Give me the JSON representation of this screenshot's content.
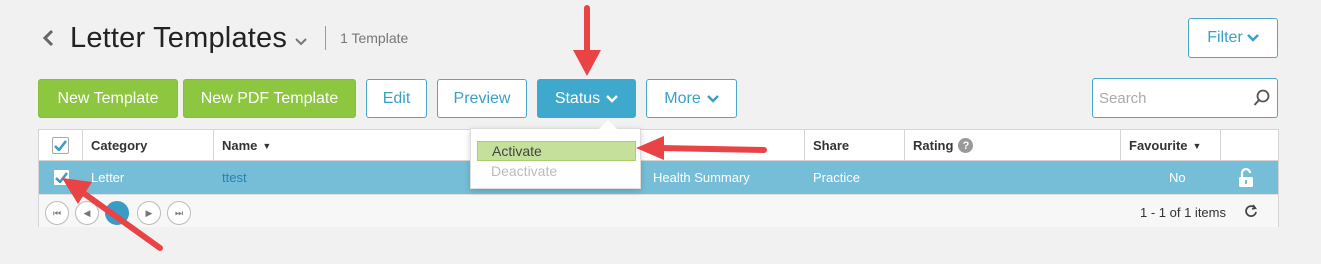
{
  "header": {
    "title": "Letter Templates",
    "count": "1 Template"
  },
  "filter": {
    "label": "Filter"
  },
  "toolbar": {
    "new_template": "New Template",
    "new_pdf_template": "New PDF Template",
    "edit": "Edit",
    "preview": "Preview",
    "status": "Status",
    "more": "More"
  },
  "search": {
    "placeholder": "Search"
  },
  "columns": {
    "category": "Category",
    "name": "Name",
    "share": "Share",
    "rating": "Rating",
    "favourite": "Favourite"
  },
  "row": {
    "category": "Letter",
    "name": "ttest",
    "type": "Health Summary",
    "share": "Practice",
    "favourite": "No"
  },
  "status_menu": {
    "activate": "Activate",
    "deactivate": "Deactivate"
  },
  "pager": {
    "info": "1 - 1 of 1 items"
  },
  "colors": {
    "green": "#8dc63f",
    "accent": "#3ea9cc",
    "selected_row": "#76bed7",
    "annotation_arrow": "#e94345"
  }
}
